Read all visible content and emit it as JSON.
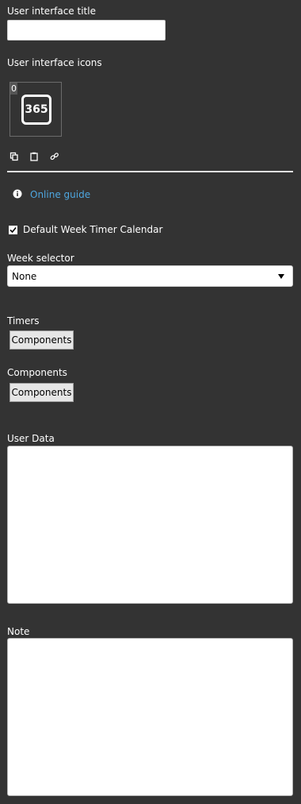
{
  "ui_title": {
    "label": "User interface title",
    "value": ""
  },
  "ui_icons": {
    "label": "User interface icons",
    "icon_index": "0",
    "icon_text": "365",
    "tools": [
      {
        "name": "copy-icon"
      },
      {
        "name": "paste-icon"
      },
      {
        "name": "link-icon"
      }
    ]
  },
  "online_guide": {
    "label": "Online guide",
    "icon": "info-icon"
  },
  "default_calendar": {
    "label": "Default Week Timer Calendar",
    "checked": true
  },
  "week_selector": {
    "label": "Week selector",
    "selected": "None"
  },
  "timers": {
    "label": "Timers",
    "button_label": "Components"
  },
  "components": {
    "label": "Components",
    "button_label": "Components"
  },
  "user_data": {
    "label": "User Data",
    "value": ""
  },
  "note": {
    "label": "Note",
    "value": ""
  },
  "colors": {
    "background": "#333333",
    "link": "#4ea7e0",
    "divider": "#e0e0e0"
  }
}
